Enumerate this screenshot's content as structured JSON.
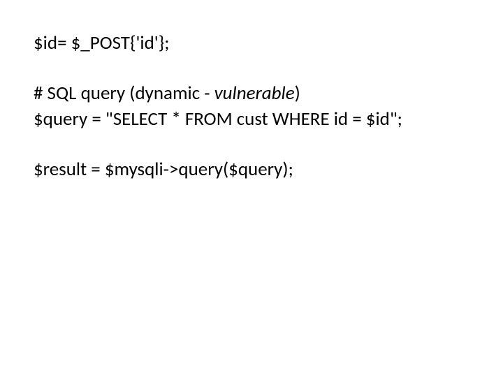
{
  "lines": {
    "l1": "$id= $_POST{'id'};",
    "l2_a": "# SQL query (dynamic - ",
    "l2_b": "vulnerable",
    "l2_c": ")",
    "l3": "$query = \"SELECT * FROM cust WHERE id = $id\";",
    "l4": "$result = $mysqli->query($query);"
  }
}
